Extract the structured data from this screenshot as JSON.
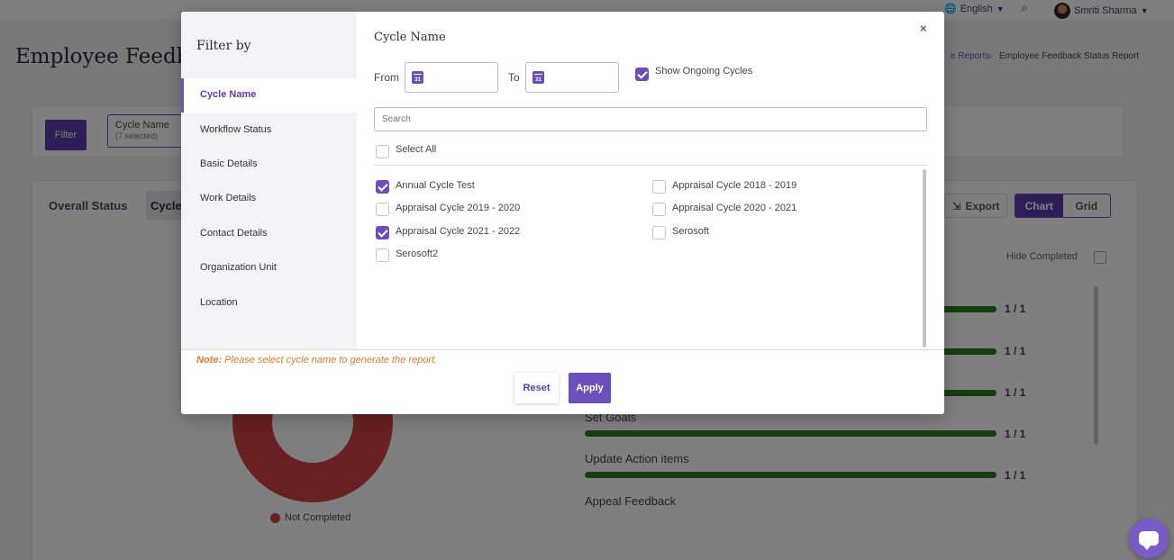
{
  "header": {
    "language": "English",
    "user_name": "Smriti Sharma"
  },
  "page": {
    "title": "Employee Feedba",
    "breadcrumb_link": "e Reports",
    "breadcrumb_sep": "›",
    "breadcrumb_current": "Employee Feedback Status Report"
  },
  "filter_bar": {
    "filter_button": "Filter",
    "chip_label": "Cycle Name",
    "chip_sub": "(7 selected)"
  },
  "status_card": {
    "tab_overall": "Overall Status",
    "tab_cycle": "Cycle",
    "export": "Export",
    "chart": "Chart",
    "grid": "Grid",
    "hide_completed": "Hide Completed",
    "legend_not_completed": "Not Completed",
    "rows": [
      {
        "label": "",
        "value": "1 / 1"
      },
      {
        "label": "",
        "value": "1 / 1"
      },
      {
        "label": "",
        "value": "1 / 1"
      },
      {
        "label": "Set Goals",
        "value": "1 / 1"
      },
      {
        "label": "Update Action items",
        "value": "1 / 1"
      },
      {
        "label": "Appeal Feedback",
        "value": ""
      }
    ]
  },
  "modal": {
    "title": "Filter by",
    "close": "×",
    "sidebar": [
      {
        "label": "Cycle Name",
        "active": true
      },
      {
        "label": "Workflow Status",
        "active": false
      },
      {
        "label": "Basic Details",
        "active": false
      },
      {
        "label": "Work Details",
        "active": false
      },
      {
        "label": "Contact Details",
        "active": false
      },
      {
        "label": "Organization Unit",
        "active": false
      },
      {
        "label": "Location",
        "active": false
      }
    ],
    "section_title": "Cycle Name",
    "from_label": "From",
    "to_label": "To",
    "calendar_day": "31",
    "show_ongoing": {
      "label": "Show Ongoing Cycles",
      "checked": true
    },
    "search_placeholder": "Search",
    "select_all": {
      "label": "Select All",
      "checked": false
    },
    "options": [
      {
        "label": "Annual Cycle Test",
        "checked": true
      },
      {
        "label": "Appraisal Cycle 2018 - 2019",
        "checked": false
      },
      {
        "label": "Appraisal Cycle 2019 - 2020",
        "checked": false
      },
      {
        "label": "Appraisal Cycle 2020 - 2021",
        "checked": false
      },
      {
        "label": "Appraisal Cycle 2021 - 2022",
        "checked": true
      },
      {
        "label": "Serosoft",
        "checked": false
      },
      {
        "label": "Serosoft2",
        "checked": false
      }
    ],
    "note_prefix": "Note:",
    "note_text": "Please select cycle name to generate the report.",
    "reset": "Reset",
    "apply": "Apply"
  },
  "colors": {
    "accent": "#6b4fbb",
    "progress": "#2d7a1f",
    "not_completed": "#d04040",
    "note": "#e07a2a"
  }
}
